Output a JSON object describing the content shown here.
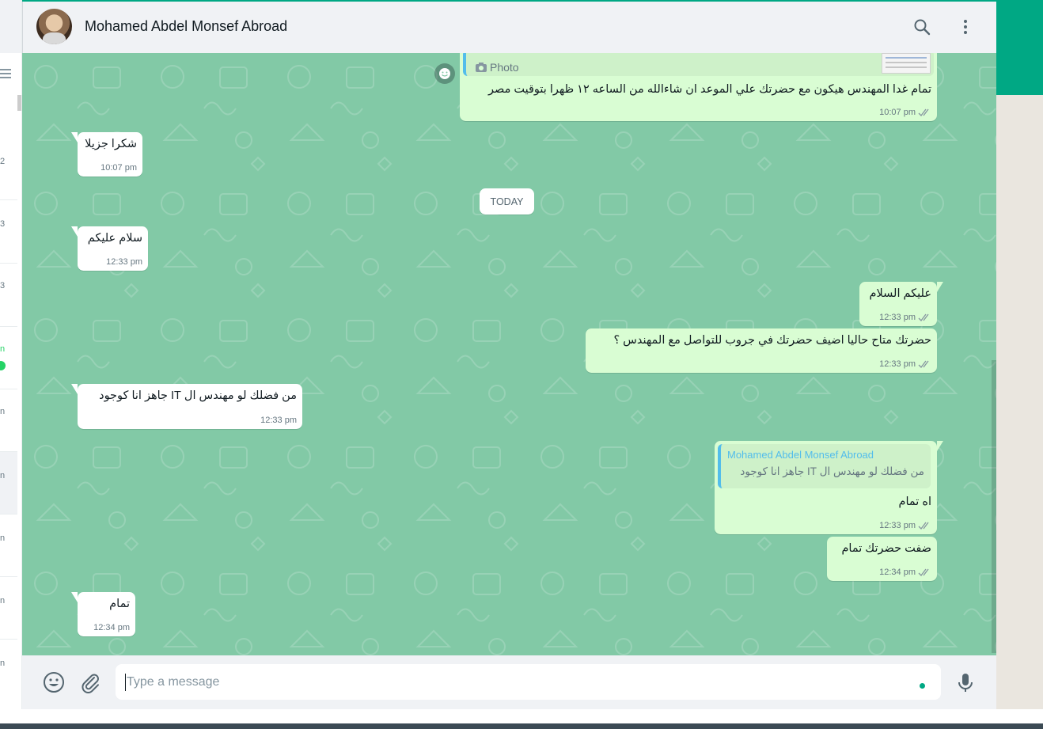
{
  "colors": {
    "accent": "#00a884",
    "chat_bg": "#82c9a6",
    "incoming_bubble": "#ffffff",
    "outgoing_bubble": "#d9fdd3",
    "read_ticks": "#8696a0",
    "quote_name": "#53bdeb"
  },
  "header": {
    "contact_name": "Mohamed Abdel Monsef Abroad",
    "icons": [
      "search-icon",
      "menu-icon"
    ]
  },
  "sidebar_sliver": {
    "time_fragments": [
      "2",
      "3",
      "3",
      "n",
      "n",
      "n",
      "n",
      "n",
      "n"
    ]
  },
  "date_separator": "TODAY",
  "messages": [
    {
      "direction": "out",
      "reply_preview": "Photo",
      "text": "تمام غدا المهندس هيكون مع حضرتك علي الموعد ان شاءالله من الساعه ١٢ ظهرا بتوقيت مصر",
      "time": "10:07 pm"
    },
    {
      "direction": "in",
      "text": "شكرا جزيلا",
      "time": "10:07 pm"
    },
    {
      "direction": "in",
      "text": "سلام عليكم",
      "time": "12:33 pm"
    },
    {
      "direction": "out",
      "text": "عليكم السلام",
      "time": "12:33 pm"
    },
    {
      "direction": "out",
      "text": "حضرتك متاح حاليا اضيف حضرتك في جروب للتواصل مع المهندس ؟",
      "time": "12:33 pm"
    },
    {
      "direction": "in",
      "text": "من فضلك لو مهندس ال IT جاهز انا كوجود",
      "time": "12:33 pm"
    },
    {
      "direction": "out",
      "quote_name": "Mohamed Abdel Monsef Abroad",
      "quote_text": "من فضلك لو مهندس ال IT جاهز انا كوجود",
      "text": "اه تمام",
      "time": "12:33 pm"
    },
    {
      "direction": "out",
      "text": "ضفت حضرتك تمام",
      "time": "12:34 pm"
    },
    {
      "direction": "in",
      "text": "تمام",
      "time": "12:34 pm"
    }
  ],
  "composer": {
    "placeholder": "Type a message",
    "icons": [
      "emoji-icon",
      "attach-icon",
      "mic-icon"
    ]
  }
}
